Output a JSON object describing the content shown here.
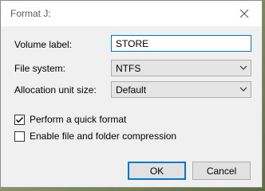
{
  "window": {
    "title": "Format J:"
  },
  "form": {
    "volume_label": {
      "label": "Volume label:",
      "value": "STORE"
    },
    "file_system": {
      "label": "File system:",
      "value": "NTFS"
    },
    "allocation": {
      "label": "Allocation unit size:",
      "value": "Default"
    }
  },
  "options": {
    "quick_format": {
      "label": "Perform a quick format",
      "checked": true
    },
    "compression": {
      "label": "Enable file and folder compression",
      "checked": false
    }
  },
  "buttons": {
    "ok": "OK",
    "cancel": "Cancel"
  },
  "icons": {
    "close": "close-icon",
    "dropdown": "chevron-down-icon",
    "check": "checkmark-icon"
  },
  "colors": {
    "focus_border": "#0078d7",
    "dialog_bg": "#f0f0f0"
  }
}
